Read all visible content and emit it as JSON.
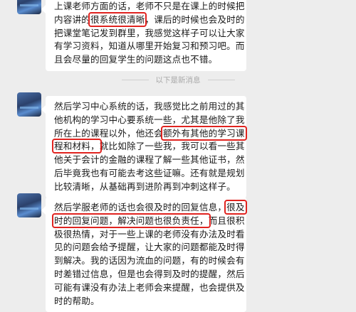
{
  "divider": {
    "text": "以下是新消息"
  },
  "messages": [
    {
      "lines": [
        {
          "parts": [
            {
              "t": "上课老师方面的话，老师不只是在课上的时候把"
            }
          ]
        },
        {
          "parts": [
            {
              "t": "内容讲的"
            },
            {
              "t": "很系统很清晰",
              "hl": true
            },
            {
              "t": "，课后的时候也会及时的"
            }
          ]
        },
        {
          "parts": [
            {
              "t": "把课堂笔记发到群里，我感觉这样子可以让大家"
            }
          ]
        },
        {
          "parts": [
            {
              "t": "有学习资料，知道从哪里开始复习和预习吧。而"
            }
          ]
        },
        {
          "parts": [
            {
              "t": "且会尽量的回复学生的问题这点也不错。"
            }
          ]
        }
      ]
    },
    {
      "lines": [
        {
          "parts": [
            {
              "t": "然后学习中心系统的话，我感觉比之前用过的其"
            }
          ]
        },
        {
          "parts": [
            {
              "t": "他机构的学习中心要系统一些，尤其是他除了我"
            }
          ]
        },
        {
          "parts": [
            {
              "t": "所在上的课程以外，他还会"
            },
            {
              "t": "额外有其他的学习课",
              "hl": true
            }
          ]
        },
        {
          "parts": [
            {
              "t": "程和材料，",
              "hl": true
            },
            {
              "t": "就比如除了一些我，我可以看一些其"
            }
          ]
        },
        {
          "parts": [
            {
              "t": "他关于会计的金融的课程了解一些其他证书，然"
            }
          ]
        },
        {
          "parts": [
            {
              "t": "后毕竟我也有可能去考这些证嘛。还有就是规划"
            }
          ]
        },
        {
          "parts": [
            {
              "t": "比较清晰，从基础再到进阶再到冲刺这样子。"
            }
          ]
        }
      ]
    },
    {
      "lines": [
        {
          "parts": [
            {
              "t": "然后学服老师的话也会很及时的回复信息，"
            },
            {
              "t": "很及",
              "hl": true
            }
          ]
        },
        {
          "parts": [
            {
              "t": "时的回复问题，解决问题也很负责任，",
              "hl": true
            },
            {
              "t": "而且很积"
            }
          ]
        },
        {
          "parts": [
            {
              "t": "极很热情，对于一些上课的老师没有办法及时看"
            }
          ]
        },
        {
          "parts": [
            {
              "t": "见的问题会给予提醒，让大家的问题都能及时得"
            }
          ]
        },
        {
          "parts": [
            {
              "t": "到解决。我的话因为流血的问题，有的时候会有"
            }
          ]
        },
        {
          "parts": [
            {
              "t": "时差错过信息，但是也会得到及时的提醒，然后"
            }
          ]
        },
        {
          "parts": [
            {
              "t": "可能有课没有办法上老师会来提醒，也会提供及"
            }
          ]
        },
        {
          "parts": [
            {
              "t": "时的帮助。"
            }
          ]
        }
      ]
    }
  ]
}
